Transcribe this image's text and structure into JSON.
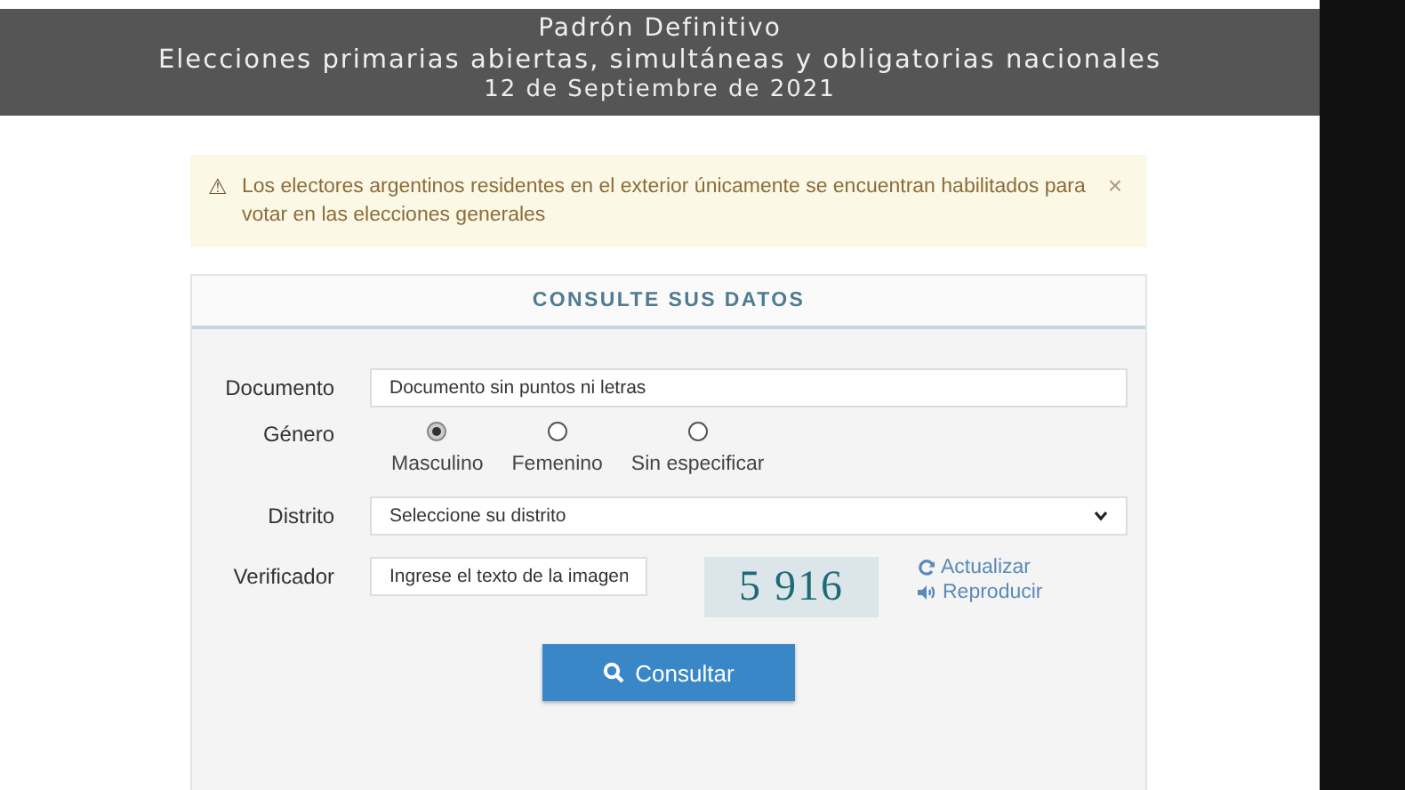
{
  "header": {
    "title": "Padrón Definitivo",
    "subtitle": "Elecciones primarias abiertas, simultáneas y obligatorias nacionales",
    "date": "12 de Septiembre de 2021"
  },
  "alert": {
    "icon": "⚠",
    "text": "Los electores argentinos residentes en el exterior únicamente se encuentran habilitados para votar en las elecciones generales",
    "close": "×"
  },
  "form": {
    "title": "CONSULTE SUS DATOS",
    "documento": {
      "label": "Documento",
      "placeholder": "Documento sin puntos ni letras"
    },
    "genero": {
      "label": "Género",
      "options": [
        {
          "label": "Masculino",
          "selected": true
        },
        {
          "label": "Femenino",
          "selected": false
        },
        {
          "label": "Sin especificar",
          "selected": false
        }
      ]
    },
    "distrito": {
      "label": "Distrito",
      "placeholder": "Seleccione su distrito"
    },
    "verificador": {
      "label": "Verificador",
      "placeholder": "Ingrese el texto de la imagen",
      "captcha_text": "5 916",
      "links": [
        {
          "kind": "refresh",
          "label": "Actualizar"
        },
        {
          "kind": "audio",
          "label": "Reproducir"
        }
      ]
    },
    "submit": "Consultar"
  }
}
